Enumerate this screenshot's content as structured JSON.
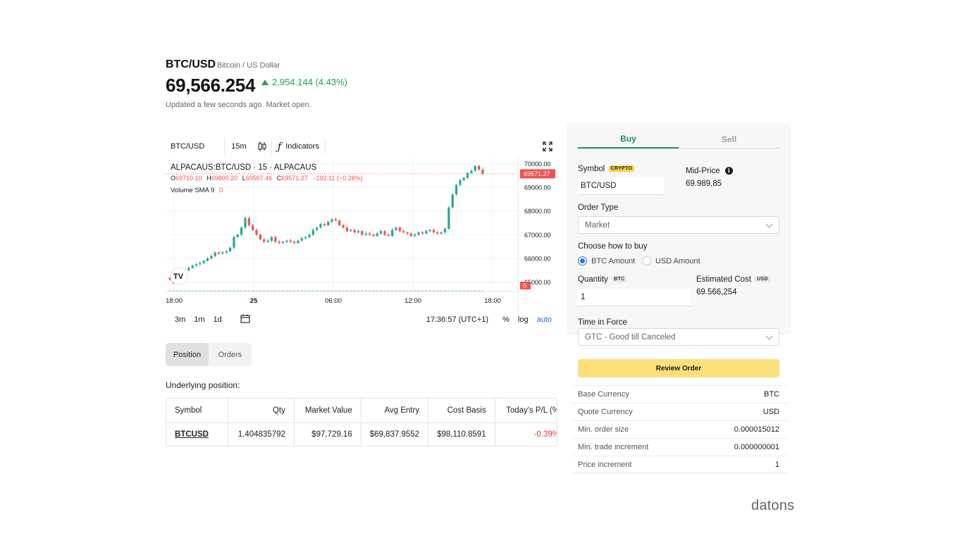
{
  "header": {
    "symbol": "BTC/USD",
    "name": "Bitcoin / US Dollar",
    "price": "69,566.254",
    "change": "2,954.144 (4.43%)",
    "status": "Updated a few seconds ago. Market open."
  },
  "chart_toolbar": {
    "symbol": "BTC/USD",
    "interval": "15m",
    "indicators": "Indicators",
    "chart_type_icon": "candles-icon",
    "expand_icon": "fullscreen-icon"
  },
  "chart_legend": {
    "title": "ALPACAUS:BTC/USD · 15 · ALPACAUS",
    "o_label": "O",
    "o_val": "69710.10",
    "h_label": "H",
    "h_val": "69800.20",
    "l_label": "L",
    "l_val": "69567.46",
    "c_label": "C",
    "c_val": "69571.27",
    "chg": "−192.11 (−0.28%)",
    "volume": "Volume SMA 9",
    "volume_val": "0"
  },
  "chart_data": {
    "type": "candlestick",
    "title": "ALPACAUS:BTC/USD · 15 · ALPACAUS",
    "ylim": [
      64600,
      70250
    ],
    "y_ticks": [
      "70000.00",
      "69000.00",
      "68000.00",
      "67000.00",
      "66000.00",
      "65000.00"
    ],
    "y_tick_values": [
      70000,
      69000,
      68000,
      67000,
      66000,
      65000
    ],
    "x_ticks": [
      "18:00",
      "25",
      "06:00",
      "12:00",
      "18:00"
    ],
    "last_price_label": "69571.27",
    "last_price": 69571.27,
    "volume_label": "0",
    "closes": [
      65100,
      64950,
      65200,
      65350,
      65500,
      65600,
      65700,
      65750,
      65800,
      65900,
      66000,
      66100,
      66250,
      66200,
      66250,
      66300,
      66450,
      66900,
      67000,
      67300,
      67700,
      67400,
      67200,
      67000,
      66800,
      66700,
      66750,
      66900,
      66700,
      66650,
      66700,
      66750,
      66700,
      66650,
      66750,
      66850,
      66900,
      67000,
      67200,
      67300,
      67450,
      67400,
      67550,
      67650,
      67600,
      67400,
      67300,
      67150,
      67200,
      67100,
      67150,
      67000,
      67050,
      67000,
      66950,
      67050,
      67150,
      67000,
      66950,
      67200,
      67300,
      67150,
      67100,
      67050,
      66950,
      67000,
      67100,
      67050,
      67150,
      67200,
      67100,
      67050,
      67100,
      67250,
      68150,
      68700,
      69100,
      69300,
      69400,
      69600,
      69700,
      69900,
      69750,
      69571
    ],
    "volumes": [
      0,
      0,
      0,
      0,
      0,
      0,
      0,
      0,
      0,
      0,
      0,
      0,
      0,
      0,
      0,
      0,
      0,
      0,
      0,
      0,
      0,
      0,
      0,
      0,
      0,
      0,
      0,
      0,
      0,
      0,
      0,
      0,
      0,
      0,
      0,
      0,
      0,
      0,
      0,
      0,
      0,
      0,
      0,
      0,
      0,
      0,
      0,
      0,
      0,
      0,
      0,
      0,
      0,
      0,
      0,
      0,
      0,
      0,
      0,
      0,
      0,
      0,
      0,
      0,
      0,
      0,
      0,
      0,
      0,
      0,
      0,
      0,
      0,
      0,
      0,
      0,
      0,
      0,
      0,
      0,
      0,
      0,
      0,
      0
    ]
  },
  "chart_bottom": {
    "r1": "3m",
    "r2": "1m",
    "r3": "1d",
    "time": "17:36:57 (UTC+1)",
    "pct": "%",
    "log": "log",
    "auto": "auto"
  },
  "position_tabs": {
    "position": "Position",
    "orders": "Orders"
  },
  "underlying_label": "Underlying position:",
  "position_table": {
    "headers": [
      "Symbol",
      "Qty",
      "Market Value",
      "Avg Entry",
      "Cost Basis",
      "Today's P/L (%"
    ],
    "row": [
      "BTCUSD",
      "1,404835792",
      "$97,729.16",
      "$69,837.9552",
      "$98,110.8591",
      "-0.39%"
    ]
  },
  "order": {
    "buy_tab": "Buy",
    "sell_tab": "Sell",
    "symbol_label": "Symbol",
    "symbol_badge": "CRYPTO",
    "symbol_value": "BTC/USD",
    "mid_label": "Mid-Price",
    "mid_value": "69.989,85",
    "order_type_label": "Order Type",
    "order_type_value": "Market",
    "how_label": "Choose how to buy",
    "opt_btc": "BTC Amount",
    "opt_usd": "USD Amount",
    "qty_label": "Quantity",
    "qty_badge": "BTC",
    "qty_value": "1",
    "est_label": "Estimated Cost",
    "est_badge": "USD",
    "est_value": "69.566,254",
    "tif_label": "Time in Force",
    "tif_value": "GTC - Good till Canceled",
    "review": "Review Order"
  },
  "asset_info": [
    {
      "k": "Base Currency",
      "v": "BTC"
    },
    {
      "k": "Quote Currency",
      "v": "USD"
    },
    {
      "k": "Min. order size",
      "v": "0.000015012"
    },
    {
      "k": "Min. trade increment",
      "v": "0.000000001"
    },
    {
      "k": "Price increment",
      "v": "1"
    }
  ],
  "logo": "datons",
  "colors": {
    "up": "#26a69a",
    "down": "#ef5350",
    "accent_green": "#1b8a6b",
    "button_yellow": "#fbe07c"
  }
}
